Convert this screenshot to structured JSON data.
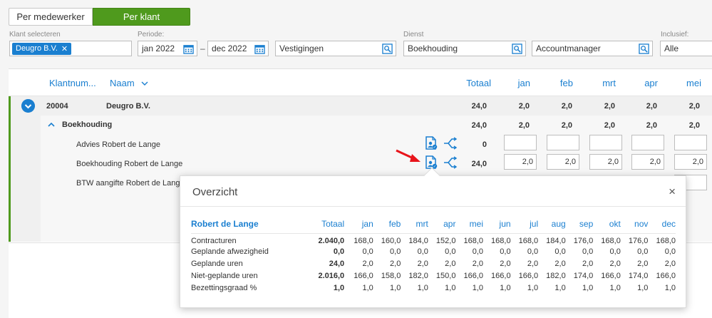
{
  "toggle": {
    "per_employee": "Per medewerker",
    "per_client": "Per klant"
  },
  "filters": {
    "client_label": "Klant selecteren",
    "client_chip": "Deugro B.V.",
    "period_label": "Periode:",
    "period_from": "jan 2022",
    "period_to": "dec 2022",
    "location_value": "Vestigingen",
    "service_label": "Dienst",
    "service_value": "Boekhouding",
    "manager_value": "Accountmanager",
    "inclusive_label": "Inclusief:",
    "inclusive_value": "Alle"
  },
  "table": {
    "headers": {
      "client_number": "Klantnum...",
      "name": "Naam",
      "total": "Totaal",
      "months": [
        "jan",
        "feb",
        "mrt",
        "apr",
        "mei"
      ]
    },
    "client": {
      "number": "20004",
      "name": "Deugro B.V.",
      "total": "24,0",
      "months": [
        "2,0",
        "2,0",
        "2,0",
        "2,0",
        "2,0"
      ]
    },
    "service": {
      "name": "Boekhouding",
      "total": "24,0",
      "months": [
        "2,0",
        "2,0",
        "2,0",
        "2,0",
        "2,0"
      ]
    },
    "rows": [
      {
        "name": "Advies Robert de Lange",
        "total": "0",
        "months": [
          "",
          "",
          "",
          "",
          ""
        ]
      },
      {
        "name": "Boekhouding Robert de Lange",
        "total": "24,0",
        "months": [
          "2,0",
          "2,0",
          "2,0",
          "2,0",
          "2,0"
        ]
      },
      {
        "name": "BTW aangifte Robert de Lange",
        "total": "",
        "months": [
          "",
          "",
          "",
          "",
          ""
        ]
      }
    ]
  },
  "popover": {
    "title": "Overzicht",
    "close": "×",
    "employee": "Robert de Lange",
    "total_header": "Totaal",
    "months": [
      "jan",
      "feb",
      "mrt",
      "apr",
      "mei",
      "jun",
      "jul",
      "aug",
      "sep",
      "okt",
      "nov",
      "dec"
    ],
    "rows": [
      {
        "label": "Contracturen",
        "total": "2.040,0",
        "values": [
          "168,0",
          "160,0",
          "184,0",
          "152,0",
          "168,0",
          "168,0",
          "168,0",
          "184,0",
          "176,0",
          "168,0",
          "176,0",
          "168,0"
        ]
      },
      {
        "label": "Geplande afwezigheid",
        "total": "0,0",
        "values": [
          "0,0",
          "0,0",
          "0,0",
          "0,0",
          "0,0",
          "0,0",
          "0,0",
          "0,0",
          "0,0",
          "0,0",
          "0,0",
          "0,0"
        ]
      },
      {
        "label": "Geplande uren",
        "total": "24,0",
        "values": [
          "2,0",
          "2,0",
          "2,0",
          "2,0",
          "2,0",
          "2,0",
          "2,0",
          "2,0",
          "2,0",
          "2,0",
          "2,0",
          "2,0"
        ]
      },
      {
        "label": "Niet-geplande uren",
        "total": "2.016,0",
        "values": [
          "166,0",
          "158,0",
          "182,0",
          "150,0",
          "166,0",
          "166,0",
          "166,0",
          "182,0",
          "174,0",
          "166,0",
          "174,0",
          "166,0"
        ]
      },
      {
        "label": "Bezettingsgraad %",
        "total": "1,0",
        "values": [
          "1,0",
          "1,0",
          "1,0",
          "1,0",
          "1,0",
          "1,0",
          "1,0",
          "1,0",
          "1,0",
          "1,0",
          "1,0",
          "1,0"
        ]
      }
    ]
  },
  "colors": {
    "accent": "#1a7fd0",
    "brand_green": "#4f9a1d",
    "arrow_red": "#e8141b"
  }
}
